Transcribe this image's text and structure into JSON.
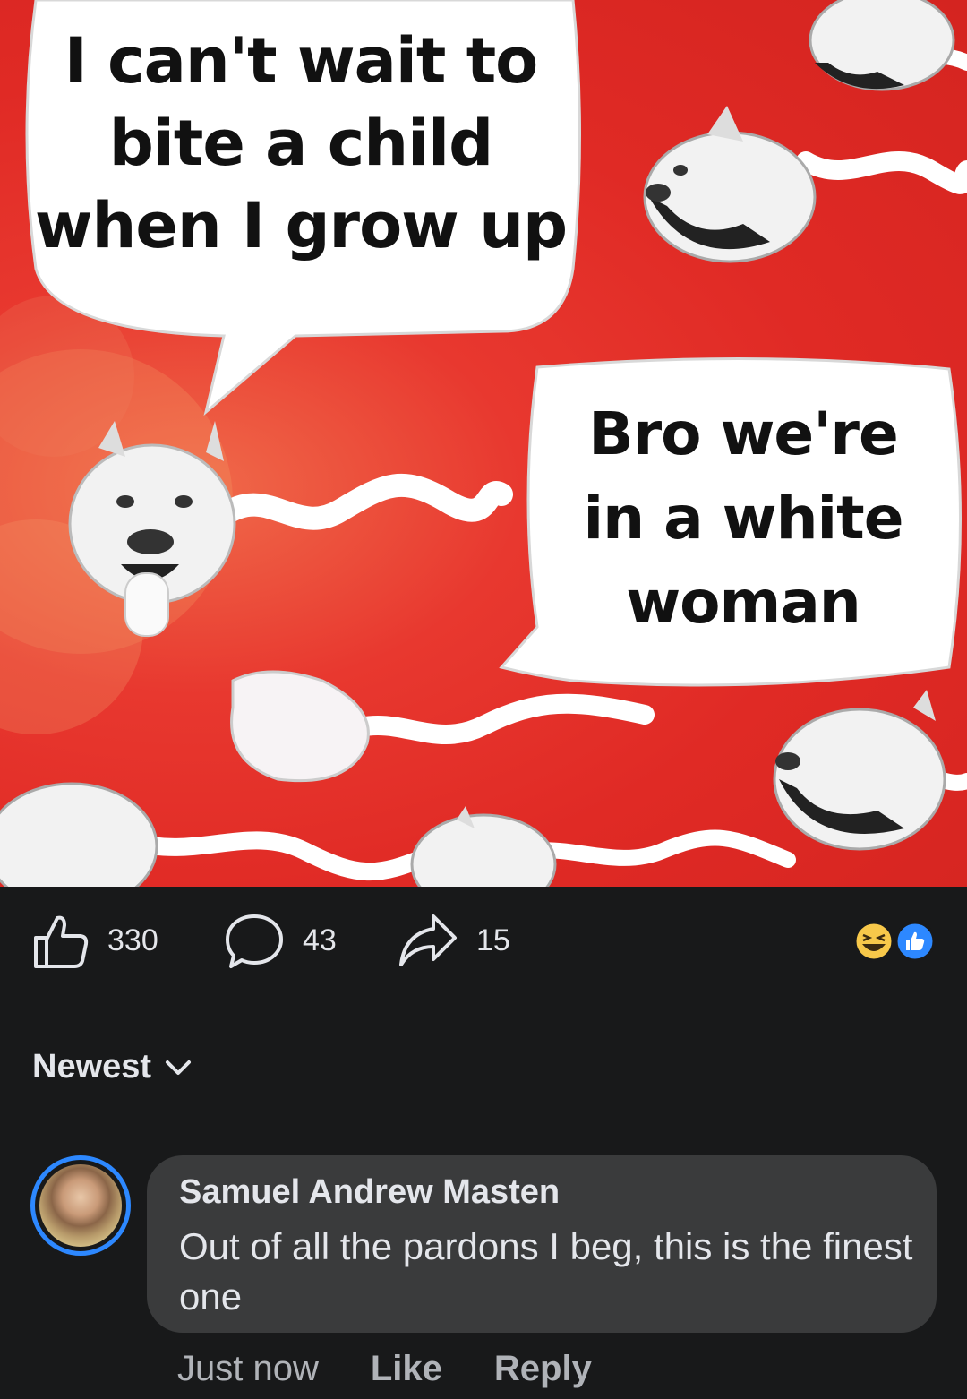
{
  "meme": {
    "bubble_left_text": "I can't wait to\nbite a child\nwhen I grow up",
    "bubble_right_text": "Bro we're\nin a white\nwoman"
  },
  "actions": {
    "like_count": "330",
    "comment_count": "43",
    "share_count": "15",
    "reactions": [
      "haha-icon",
      "like-icon"
    ]
  },
  "sort": {
    "label": "Newest"
  },
  "comment": {
    "author": "Samuel Andrew Masten",
    "text": "Out of all the pardons I beg, this is the finest one",
    "time": "Just now",
    "like_label": "Like",
    "reply_label": "Reply"
  },
  "colors": {
    "background": "#18191a",
    "bubble": "#3a3b3c",
    "text": "#e4e6eb",
    "muted": "#b0b3b8",
    "accent": "#2d88ff",
    "meme_red": "#e02a25"
  }
}
